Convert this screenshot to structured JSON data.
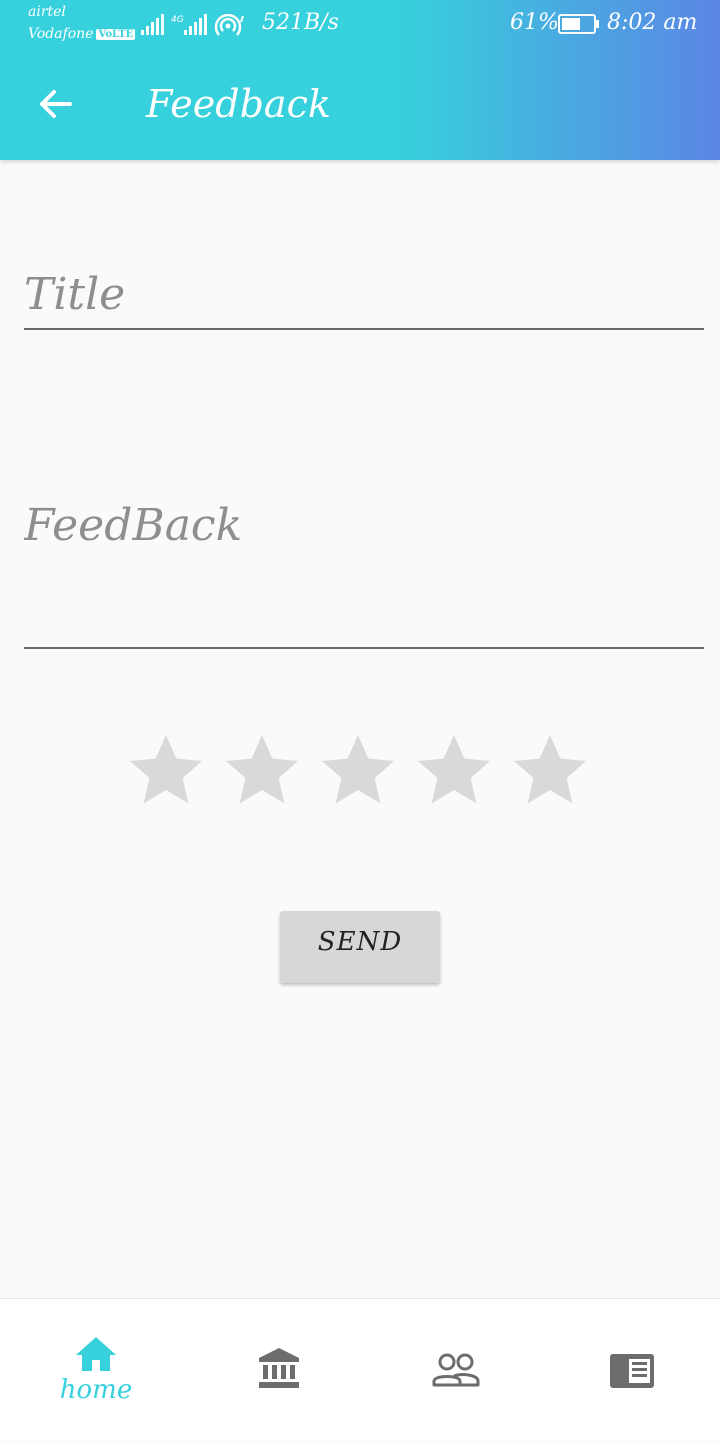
{
  "status_bar": {
    "carrier_1": "airtel",
    "carrier_2": "Vodafone",
    "volte_badge": "VoLTE",
    "network_type": "4G",
    "net_speed": "521B/s",
    "battery_percent": "61%",
    "battery_level": 0.61,
    "time": "8:02 am"
  },
  "header": {
    "title": "Feedback",
    "back_icon": "arrow-left-icon"
  },
  "form": {
    "title_placeholder": "Title",
    "title_value": "",
    "feedback_placeholder": "FeedBack",
    "feedback_value": ""
  },
  "rating": {
    "max_stars": 5,
    "value": 0,
    "star_color_empty": "#d9d9d9"
  },
  "send_button": {
    "label": "SEND"
  },
  "bottom_nav": {
    "items": [
      {
        "icon": "home-icon",
        "label": "home",
        "active": true
      },
      {
        "icon": "bank-icon",
        "label": "",
        "active": false
      },
      {
        "icon": "people-icon",
        "label": "",
        "active": false
      },
      {
        "icon": "newspaper-icon",
        "label": "",
        "active": false
      }
    ],
    "active_color": "#36d1dc",
    "inactive_color": "#6d6d6d"
  },
  "colors": {
    "header_gradient_start": "#36d1dc",
    "header_gradient_end": "#5b86e5",
    "background": "#fafafa"
  }
}
